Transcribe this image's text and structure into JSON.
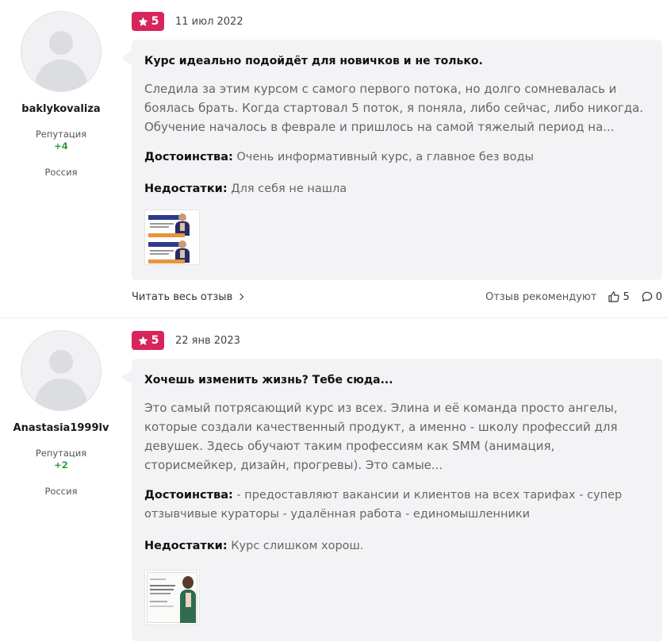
{
  "reviews": [
    {
      "author": {
        "username": "baklykovaliza",
        "reputation_label": "Репутация",
        "reputation_value": "+4",
        "country": "Россия"
      },
      "rating": "5",
      "date": "11 июл 2022",
      "title": "Курс идеально подойдёт для новичков и не только.",
      "text": "Следила за этим курсом с самого первого потока, но долго сомневалась и боялась брать. Когда стартовал 5 поток, я поняла, либо сейчас, либо никогда. Обучение началось в феврале и пришлось на самой тяжелый период на...",
      "pros_label": "Достоинства:",
      "pros": "Очень информативный курс, а главное без воды",
      "cons_label": "Недостатки:",
      "cons": "Для себя не нашла",
      "read_more": "Читать весь отзыв",
      "recommend": "Отзыв рекомендуют",
      "likes": "5",
      "comments": "0"
    },
    {
      "author": {
        "username": "Anastasia1999lv",
        "reputation_label": "Репутация",
        "reputation_value": "+2",
        "country": "Россия"
      },
      "rating": "5",
      "date": "22 янв 2023",
      "title": "Хочешь изменить жизнь? Тебе сюда...",
      "text": "Это самый потрясающий курс из всех. Элина и её команда просто ангелы, которые создали качественный продукт, а именно - школу профессий для девушек. Здесь обучают таким профессиям как SMM (анимация, сторисмейкер, дизайн, прогревы). Это самые...",
      "pros_label": "Достоинства:",
      "pros": "- предоставляют вакансии и клиентов на всех тарифах - супер отзывчивые кураторы - удалённая работа - единомышленники",
      "cons_label": "Недостатки:",
      "cons": "Курс слишком хорош."
    }
  ],
  "colors": {
    "badge": "#d8255b",
    "bubble": "#f3f3f5",
    "reputation": "#2e9c3f"
  },
  "icons": [
    "star-icon",
    "chevron-right-icon",
    "thumbs-up-icon",
    "comment-icon"
  ]
}
